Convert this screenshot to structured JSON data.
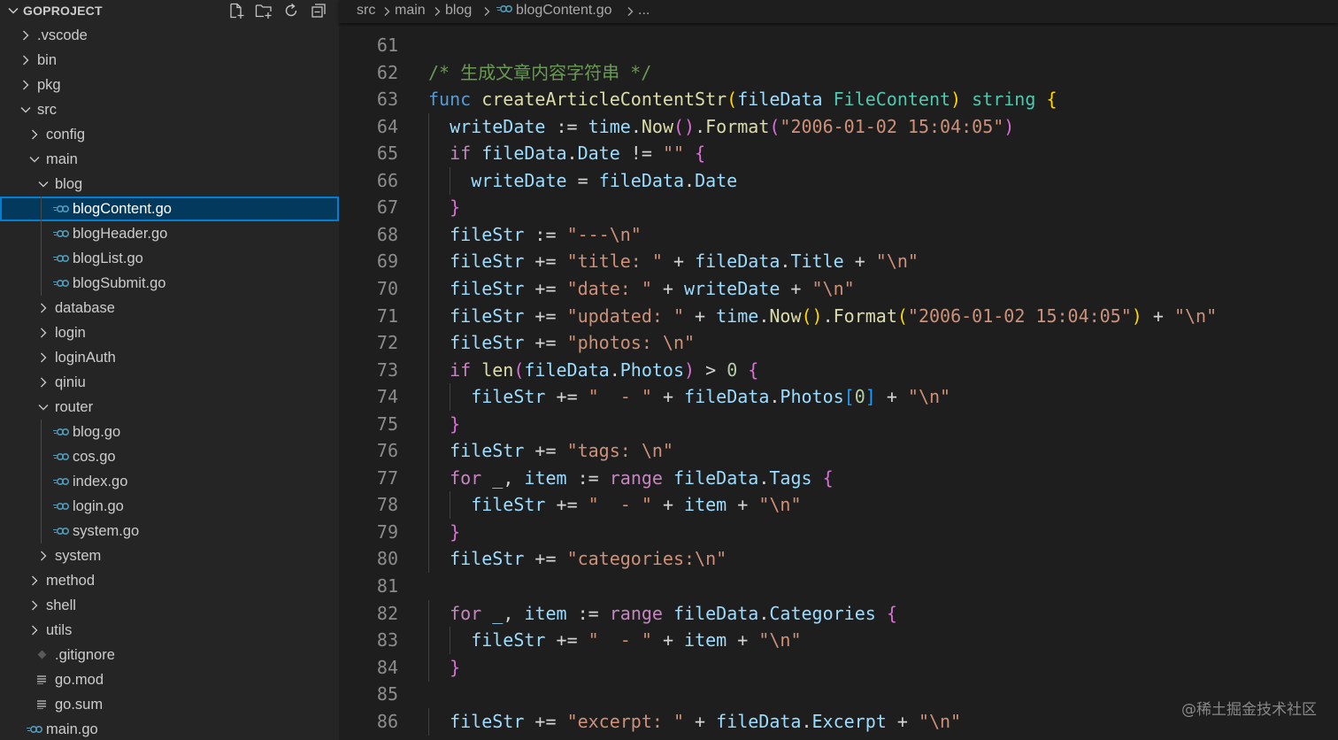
{
  "explorer": {
    "title": "GOPROJECT",
    "actions": [
      {
        "name": "new-file-icon",
        "tooltip": "New File..."
      },
      {
        "name": "new-folder-icon",
        "tooltip": "New Folder..."
      },
      {
        "name": "refresh-icon",
        "tooltip": "Refresh Explorer"
      },
      {
        "name": "collapse-all-icon",
        "tooltip": "Collapse Folders in Explorer"
      }
    ],
    "tree": [
      {
        "label": ".vscode",
        "type": "folder",
        "open": false,
        "depth": 0
      },
      {
        "label": "bin",
        "type": "folder",
        "open": false,
        "depth": 0
      },
      {
        "label": "pkg",
        "type": "folder",
        "open": false,
        "depth": 0
      },
      {
        "label": "src",
        "type": "folder",
        "open": true,
        "depth": 0
      },
      {
        "label": "config",
        "type": "folder",
        "open": false,
        "depth": 1
      },
      {
        "label": "main",
        "type": "folder",
        "open": true,
        "depth": 1
      },
      {
        "label": "blog",
        "type": "folder",
        "open": true,
        "depth": 2
      },
      {
        "label": "blogContent.go",
        "type": "go",
        "depth": 3,
        "selected": true
      },
      {
        "label": "blogHeader.go",
        "type": "go",
        "depth": 3
      },
      {
        "label": "blogList.go",
        "type": "go",
        "depth": 3
      },
      {
        "label": "blogSubmit.go",
        "type": "go",
        "depth": 3
      },
      {
        "label": "database",
        "type": "folder",
        "open": false,
        "depth": 2
      },
      {
        "label": "login",
        "type": "folder",
        "open": false,
        "depth": 2
      },
      {
        "label": "loginAuth",
        "type": "folder",
        "open": false,
        "depth": 2
      },
      {
        "label": "qiniu",
        "type": "folder",
        "open": false,
        "depth": 2
      },
      {
        "label": "router",
        "type": "folder",
        "open": true,
        "depth": 2
      },
      {
        "label": "blog.go",
        "type": "go",
        "depth": 3
      },
      {
        "label": "cos.go",
        "type": "go",
        "depth": 3
      },
      {
        "label": "index.go",
        "type": "go",
        "depth": 3
      },
      {
        "label": "login.go",
        "type": "go",
        "depth": 3
      },
      {
        "label": "system.go",
        "type": "go",
        "depth": 3
      },
      {
        "label": "system",
        "type": "folder",
        "open": false,
        "depth": 2
      },
      {
        "label": "method",
        "type": "folder",
        "open": false,
        "depth": 1
      },
      {
        "label": "shell",
        "type": "folder",
        "open": false,
        "depth": 1
      },
      {
        "label": "utils",
        "type": "folder",
        "open": false,
        "depth": 1
      },
      {
        "label": ".gitignore",
        "type": "git",
        "depth": 1
      },
      {
        "label": "go.mod",
        "type": "lines",
        "depth": 1
      },
      {
        "label": "go.sum",
        "type": "lines",
        "depth": 1
      },
      {
        "label": "main.go",
        "type": "go",
        "depth": 0
      }
    ]
  },
  "breadcrumb": [
    {
      "label": "src"
    },
    {
      "label": "main"
    },
    {
      "label": "blog"
    },
    {
      "label": "blogContent.go",
      "icon": "go-file-icon"
    },
    {
      "label": "..."
    }
  ],
  "editor": {
    "lines": [
      {
        "n": "61",
        "indent": 0,
        "tokens": []
      },
      {
        "n": "62",
        "indent": 0,
        "tokens": [
          {
            "t": "/* 生成文章内容字符串 */",
            "c": "cmt"
          }
        ]
      },
      {
        "n": "63",
        "indent": 0,
        "tokens": [
          {
            "t": "func ",
            "c": "kw"
          },
          {
            "t": "createArticleContentStr",
            "c": "fn"
          },
          {
            "t": "(",
            "c": "br1"
          },
          {
            "t": "fileData ",
            "c": "var"
          },
          {
            "t": "FileContent",
            "c": "type"
          },
          {
            "t": ")",
            "c": "br1"
          },
          {
            "t": " ",
            "c": ""
          },
          {
            "t": "string",
            "c": "type"
          },
          {
            "t": " ",
            "c": ""
          },
          {
            "t": "{",
            "c": "br1"
          }
        ]
      },
      {
        "n": "64",
        "indent": 1,
        "tokens": [
          {
            "t": "writeDate",
            "c": "var"
          },
          {
            "t": " := ",
            "c": ""
          },
          {
            "t": "time",
            "c": "var"
          },
          {
            "t": ".",
            "c": ""
          },
          {
            "t": "Now",
            "c": "fn"
          },
          {
            "t": "()",
            "c": "br2"
          },
          {
            "t": ".",
            "c": ""
          },
          {
            "t": "Format",
            "c": "fn"
          },
          {
            "t": "(",
            "c": "br2"
          },
          {
            "t": "\"2006-01-02 15:04:05\"",
            "c": "str"
          },
          {
            "t": ")",
            "c": "br2"
          }
        ]
      },
      {
        "n": "65",
        "indent": 1,
        "tokens": [
          {
            "t": "if ",
            "c": "ctl"
          },
          {
            "t": "fileData",
            "c": "var"
          },
          {
            "t": ".",
            "c": ""
          },
          {
            "t": "Date",
            "c": "var"
          },
          {
            "t": " != ",
            "c": ""
          },
          {
            "t": "\"\"",
            "c": "str"
          },
          {
            "t": " ",
            "c": ""
          },
          {
            "t": "{",
            "c": "br2"
          }
        ]
      },
      {
        "n": "66",
        "indent": 2,
        "tokens": [
          {
            "t": "writeDate",
            "c": "var"
          },
          {
            "t": " = ",
            "c": ""
          },
          {
            "t": "fileData",
            "c": "var"
          },
          {
            "t": ".",
            "c": ""
          },
          {
            "t": "Date",
            "c": "var"
          }
        ]
      },
      {
        "n": "67",
        "indent": 1,
        "tokens": [
          {
            "t": "}",
            "c": "br2"
          }
        ]
      },
      {
        "n": "68",
        "indent": 1,
        "tokens": [
          {
            "t": "fileStr",
            "c": "var"
          },
          {
            "t": " := ",
            "c": ""
          },
          {
            "t": "\"---\\n\"",
            "c": "str"
          }
        ]
      },
      {
        "n": "69",
        "indent": 1,
        "tokens": [
          {
            "t": "fileStr",
            "c": "var"
          },
          {
            "t": " += ",
            "c": ""
          },
          {
            "t": "\"title: \"",
            "c": "str"
          },
          {
            "t": " + ",
            "c": ""
          },
          {
            "t": "fileData",
            "c": "var"
          },
          {
            "t": ".",
            "c": ""
          },
          {
            "t": "Title",
            "c": "var"
          },
          {
            "t": " + ",
            "c": ""
          },
          {
            "t": "\"\\n\"",
            "c": "str"
          }
        ]
      },
      {
        "n": "70",
        "indent": 1,
        "tokens": [
          {
            "t": "fileStr",
            "c": "var"
          },
          {
            "t": " += ",
            "c": ""
          },
          {
            "t": "\"date: \"",
            "c": "str"
          },
          {
            "t": " + ",
            "c": ""
          },
          {
            "t": "writeDate",
            "c": "var"
          },
          {
            "t": " + ",
            "c": ""
          },
          {
            "t": "\"\\n\"",
            "c": "str"
          }
        ]
      },
      {
        "n": "71",
        "indent": 1,
        "tokens": [
          {
            "t": "fileStr",
            "c": "var"
          },
          {
            "t": " += ",
            "c": ""
          },
          {
            "t": "\"updated: \"",
            "c": "str"
          },
          {
            "t": " + ",
            "c": ""
          },
          {
            "t": "time",
            "c": "var"
          },
          {
            "t": ".",
            "c": ""
          },
          {
            "t": "Now",
            "c": "fn"
          },
          {
            "t": "()",
            "c": "br1"
          },
          {
            "t": ".",
            "c": ""
          },
          {
            "t": "Format",
            "c": "fn"
          },
          {
            "t": "(",
            "c": "br1"
          },
          {
            "t": "\"2006-01-02 15:04:05\"",
            "c": "str"
          },
          {
            "t": ")",
            "c": "br1"
          },
          {
            "t": " + ",
            "c": ""
          },
          {
            "t": "\"\\n\"",
            "c": "str"
          }
        ]
      },
      {
        "n": "72",
        "indent": 1,
        "tokens": [
          {
            "t": "fileStr",
            "c": "var"
          },
          {
            "t": " += ",
            "c": ""
          },
          {
            "t": "\"photos: \\n\"",
            "c": "str"
          }
        ]
      },
      {
        "n": "73",
        "indent": 1,
        "tokens": [
          {
            "t": "if ",
            "c": "ctl"
          },
          {
            "t": "len",
            "c": "fn"
          },
          {
            "t": "(",
            "c": "br2"
          },
          {
            "t": "fileData",
            "c": "var"
          },
          {
            "t": ".",
            "c": ""
          },
          {
            "t": "Photos",
            "c": "var"
          },
          {
            "t": ")",
            "c": "br2"
          },
          {
            "t": " > ",
            "c": ""
          },
          {
            "t": "0",
            "c": "num"
          },
          {
            "t": " ",
            "c": ""
          },
          {
            "t": "{",
            "c": "br2"
          }
        ]
      },
      {
        "n": "74",
        "indent": 2,
        "tokens": [
          {
            "t": "fileStr",
            "c": "var"
          },
          {
            "t": " += ",
            "c": ""
          },
          {
            "t": "\"  - \"",
            "c": "str"
          },
          {
            "t": " + ",
            "c": ""
          },
          {
            "t": "fileData",
            "c": "var"
          },
          {
            "t": ".",
            "c": ""
          },
          {
            "t": "Photos",
            "c": "var"
          },
          {
            "t": "[",
            "c": "br3"
          },
          {
            "t": "0",
            "c": "num"
          },
          {
            "t": "]",
            "c": "br3"
          },
          {
            "t": " + ",
            "c": ""
          },
          {
            "t": "\"\\n\"",
            "c": "str"
          }
        ]
      },
      {
        "n": "75",
        "indent": 1,
        "tokens": [
          {
            "t": "}",
            "c": "br2"
          }
        ]
      },
      {
        "n": "76",
        "indent": 1,
        "tokens": [
          {
            "t": "fileStr",
            "c": "var"
          },
          {
            "t": " += ",
            "c": ""
          },
          {
            "t": "\"tags: \\n\"",
            "c": "str"
          }
        ]
      },
      {
        "n": "77",
        "indent": 1,
        "tokens": [
          {
            "t": "for ",
            "c": "ctl"
          },
          {
            "t": "_",
            "c": "var"
          },
          {
            "t": ", ",
            "c": ""
          },
          {
            "t": "item",
            "c": "var"
          },
          {
            "t": " := ",
            "c": ""
          },
          {
            "t": "range ",
            "c": "ctl"
          },
          {
            "t": "fileData",
            "c": "var"
          },
          {
            "t": ".",
            "c": ""
          },
          {
            "t": "Tags",
            "c": "var"
          },
          {
            "t": " ",
            "c": ""
          },
          {
            "t": "{",
            "c": "br2"
          }
        ]
      },
      {
        "n": "78",
        "indent": 2,
        "tokens": [
          {
            "t": "fileStr",
            "c": "var"
          },
          {
            "t": " += ",
            "c": ""
          },
          {
            "t": "\"  - \"",
            "c": "str"
          },
          {
            "t": " + ",
            "c": ""
          },
          {
            "t": "item",
            "c": "var"
          },
          {
            "t": " + ",
            "c": ""
          },
          {
            "t": "\"\\n\"",
            "c": "str"
          }
        ]
      },
      {
        "n": "79",
        "indent": 1,
        "tokens": [
          {
            "t": "}",
            "c": "br2"
          }
        ]
      },
      {
        "n": "80",
        "indent": 1,
        "tokens": [
          {
            "t": "fileStr",
            "c": "var"
          },
          {
            "t": " += ",
            "c": ""
          },
          {
            "t": "\"categories:\\n\"",
            "c": "str"
          }
        ]
      },
      {
        "n": "81",
        "indent": 0,
        "tokens": []
      },
      {
        "n": "82",
        "indent": 1,
        "tokens": [
          {
            "t": "for ",
            "c": "ctl"
          },
          {
            "t": "_",
            "c": "var"
          },
          {
            "t": ", ",
            "c": ""
          },
          {
            "t": "item",
            "c": "var"
          },
          {
            "t": " := ",
            "c": ""
          },
          {
            "t": "range ",
            "c": "ctl"
          },
          {
            "t": "fileData",
            "c": "var"
          },
          {
            "t": ".",
            "c": ""
          },
          {
            "t": "Categories",
            "c": "var"
          },
          {
            "t": " ",
            "c": ""
          },
          {
            "t": "{",
            "c": "br2"
          }
        ]
      },
      {
        "n": "83",
        "indent": 2,
        "tokens": [
          {
            "t": "fileStr",
            "c": "var"
          },
          {
            "t": " += ",
            "c": ""
          },
          {
            "t": "\"  - \"",
            "c": "str"
          },
          {
            "t": " + ",
            "c": ""
          },
          {
            "t": "item",
            "c": "var"
          },
          {
            "t": " + ",
            "c": ""
          },
          {
            "t": "\"\\n\"",
            "c": "str"
          }
        ]
      },
      {
        "n": "84",
        "indent": 1,
        "tokens": [
          {
            "t": "}",
            "c": "br2"
          }
        ]
      },
      {
        "n": "85",
        "indent": 0,
        "tokens": []
      },
      {
        "n": "86",
        "indent": 1,
        "tokens": [
          {
            "t": "fileStr",
            "c": "var"
          },
          {
            "t": " += ",
            "c": ""
          },
          {
            "t": "\"excerpt: \"",
            "c": "str"
          },
          {
            "t": " + ",
            "c": ""
          },
          {
            "t": "fileData",
            "c": "var"
          },
          {
            "t": ".",
            "c": ""
          },
          {
            "t": "Excerpt",
            "c": "var"
          },
          {
            "t": " + ",
            "c": ""
          },
          {
            "t": "\"\\n\"",
            "c": "str"
          }
        ]
      }
    ]
  },
  "watermark": "@稀土掘金技术社区",
  "colors": {
    "sidebar_bg": "#252526",
    "editor_bg": "#1e1e1e",
    "selection_bg": "#04395e",
    "selection_border": "#007fd4",
    "go_icon": "#519aba"
  }
}
